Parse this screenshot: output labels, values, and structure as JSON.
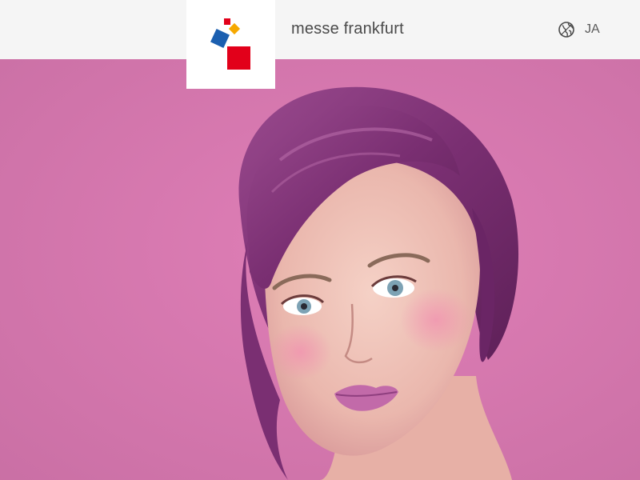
{
  "header": {
    "brand_name": "messe frankfurt",
    "language": {
      "label": "JA",
      "icon": "globe-icon"
    },
    "logo": {
      "icon": "messe-frankfurt-logo",
      "colors": {
        "red_small": "#e2001a",
        "yellow": "#f6a800",
        "blue": "#1b5fb0",
        "red_large": "#e2001a"
      }
    }
  },
  "hero": {
    "image": "portrait-woman-violet-hair",
    "background_color": "#d978ad"
  }
}
